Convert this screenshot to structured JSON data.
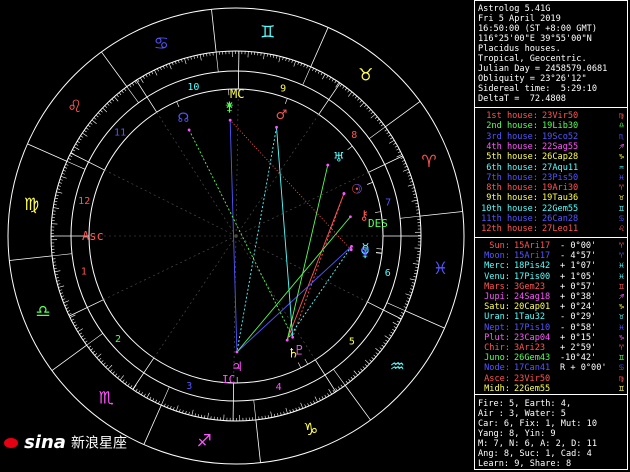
{
  "header": {
    "lines": [
      "Astrolog 5.41G",
      "Fri 5 April 2019",
      "16:50:00 (ST +8:00 GMT)",
      "116°25'00\"E 39°55'00\"N",
      "Placidus houses.",
      "Tropical, Geocentric.",
      "Julian Day = 2458579.0681",
      "Obliquity = 23°26'12\"",
      "Sidereal time:  5:29:10",
      "DeltaT =  72.4808"
    ]
  },
  "houses": [
    {
      "label": "1st house:",
      "value": "23Vir50",
      "color": "#ff5555",
      "sign": "♍"
    },
    {
      "label": "2nd house:",
      "value": "19Lib30",
      "color": "#55ff55",
      "sign": "♎"
    },
    {
      "label": "3rd house:",
      "value": "19Sco52",
      "color": "#5555ff",
      "sign": "♏"
    },
    {
      "label": "4th house:",
      "value": "22Sag55",
      "color": "#ff55ff",
      "sign": "♐"
    },
    {
      "label": "5th house:",
      "value": "26Cap28",
      "color": "#ffff55",
      "sign": "♑"
    },
    {
      "label": "6th house:",
      "value": "27Aqu11",
      "color": "#55ffff",
      "sign": "♒"
    },
    {
      "label": "7th house:",
      "value": "23Pis50",
      "color": "#5555ff",
      "sign": "♓"
    },
    {
      "label": "8th house:",
      "value": "19Ari30",
      "color": "#ff5555",
      "sign": "♈"
    },
    {
      "label": "9th house:",
      "value": "19Tau36",
      "color": "#ffff55",
      "sign": "♉"
    },
    {
      "label": "10th house:",
      "value": "22Gem55",
      "color": "#55ffff",
      "sign": "♊"
    },
    {
      "label": "11th house:",
      "value": "26Can28",
      "color": "#5555ff",
      "sign": "♋"
    },
    {
      "label": "12th house:",
      "value": "27Leo11",
      "color": "#ff5555",
      "sign": "♌"
    }
  ],
  "planets": [
    {
      "name": "Sun:",
      "pos": "15Ari17",
      "speed": "- 0°00'",
      "color": "#ff5555",
      "glyph": "♈"
    },
    {
      "name": "Moon:",
      "pos": "15Ari17",
      "speed": "- 4°57'",
      "color": "#5555ff",
      "glyph": "♈"
    },
    {
      "name": "Merc:",
      "pos": "18Pis42",
      "speed": "+ 1°07'",
      "color": "#55ffff",
      "glyph": "♓"
    },
    {
      "name": "Venu:",
      "pos": "17Pis00",
      "speed": "+ 1°05'",
      "color": "#55ffff",
      "glyph": "♓"
    },
    {
      "name": "Mars:",
      "pos": "3Gem23",
      "speed": "+ 0°57'",
      "color": "#ff5555",
      "glyph": "♊"
    },
    {
      "name": "Jupi:",
      "pos": "24Sag18",
      "speed": "+ 0°38'",
      "color": "#ff55ff",
      "glyph": "♐"
    },
    {
      "name": "Satu:",
      "pos": "20Cap01",
      "speed": "+ 0°24'",
      "color": "#ffff55",
      "glyph": "♑"
    },
    {
      "name": "Uran:",
      "pos": "1Tau32",
      "speed": "- 0°29'",
      "color": "#55ffff",
      "glyph": "♉"
    },
    {
      "name": "Nept:",
      "pos": "17Pis10",
      "speed": "- 0°58'",
      "color": "#5555ff",
      "glyph": "♓"
    },
    {
      "name": "Plut:",
      "pos": "23Cap04",
      "speed": "+ 0°15'",
      "color": "#ff55ff",
      "glyph": "♑"
    },
    {
      "name": "Chir:",
      "pos": "3Ari23",
      "speed": "+ 2°59'",
      "color": "#ff5555",
      "glyph": "♈"
    },
    {
      "name": "Juno:",
      "pos": "26Gem43",
      "speed": "-10°42'",
      "color": "#55ff55",
      "glyph": "♊"
    },
    {
      "name": "Node:",
      "pos": "17Can41",
      "speed": "R + 0°00'",
      "color": "#5555ff",
      "glyph": "♋"
    },
    {
      "name": "Asce:",
      "pos": "23Vir50",
      "speed": "",
      "color": "#ff5555",
      "glyph": "♍"
    },
    {
      "name": "Midh:",
      "pos": "22Gem55",
      "speed": "",
      "color": "#ffff55",
      "glyph": "♊"
    }
  ],
  "stats": [
    "Fire: 5, Earth: 4,",
    "Air : 3, Water: 5",
    "Car: 6, Fix: 1, Mut: 10",
    "Yang: 8, Yin: 9",
    "M: 7, N: 6, A: 2, D: 11",
    "Ang: 8, Suc: 1, Cad: 4",
    "Learn: 9, Share: 8"
  ],
  "wheel": {
    "cusp_labels": [
      "Asc",
      "MC",
      "DES",
      "IC"
    ],
    "house_numbers": [
      "1",
      "2",
      "3",
      "4",
      "5",
      "6",
      "7",
      "8",
      "9",
      "10",
      "11",
      "12"
    ]
  },
  "logo": {
    "brand": "sina",
    "text": "新浪星座"
  }
}
